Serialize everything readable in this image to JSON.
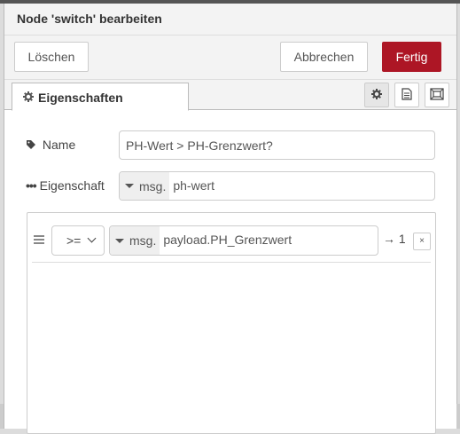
{
  "tray": {
    "title": "Node 'switch' bearbeiten"
  },
  "toolbar": {
    "delete_label": "Löschen",
    "cancel_label": "Abbrechen",
    "done_label": "Fertig"
  },
  "tabs": {
    "properties_label": "Eigenschaften",
    "icons": [
      "gear-icon",
      "description-icon",
      "appearance-icon"
    ]
  },
  "form": {
    "name_label": "Name",
    "name_value": "PH-Wert > PH-Grenzwert?",
    "property_label": "Eigenschaft",
    "property_type": "msg.",
    "property_value": "ph-wert"
  },
  "rules": [
    {
      "operator": ">=",
      "value_type": "msg.",
      "value": "payload.PH_Grenzwert",
      "output": "→ 1",
      "remove_label": "×"
    }
  ],
  "colors": {
    "primary": "#ad1625",
    "topbar": "#555555"
  }
}
